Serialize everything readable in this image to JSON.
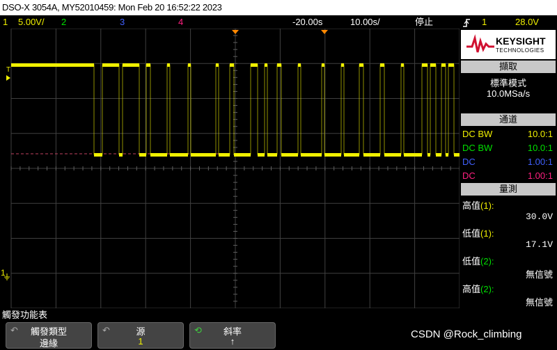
{
  "title_bar": {
    "text": "DSO-X 3054A, MY52010459: Mon Feb 20 16:52:22 2023"
  },
  "status_bar": {
    "ch1_num": "1",
    "ch1_scale": "5.00V/",
    "ch2_num": "2",
    "ch3_num": "3",
    "ch4_num": "4",
    "time_offset": "-20.00s",
    "time_scale": "10.00s/",
    "run_state": "停止",
    "trigger_icon": "rising-edge-icon",
    "trigger_source": "1",
    "trigger_level": "28.0V"
  },
  "colors": {
    "ch1": "#f0f000",
    "ch2": "#00e000",
    "ch3": "#4060ff",
    "ch4": "#ff2080",
    "trigger_marker": "#ff8800"
  },
  "screen": {
    "ch1_marker": "1",
    "trigger_level_marker": "T"
  },
  "side_panel": {
    "brand": "KEYSIGHT",
    "brand_sub": "TECHNOLOGIES",
    "acq_header": "擷取",
    "acq_mode": "標準模式",
    "acq_rate": "10.0MSa/s",
    "chan_header": "通道",
    "channels": [
      {
        "coupling": "DC BW",
        "ratio": "10.0:1"
      },
      {
        "coupling": "DC BW",
        "ratio": "10.0:1"
      },
      {
        "coupling": "DC",
        "ratio": "1.00:1"
      },
      {
        "coupling": "DC",
        "ratio": "1.00:1"
      }
    ],
    "meas_header": "量測",
    "measurements": [
      {
        "label": "高值",
        "src": "(1):",
        "value": "30.0V"
      },
      {
        "label": "低值",
        "src": "(1):",
        "value": "17.1V"
      },
      {
        "label": "低值",
        "src": "(2):",
        "value": "無信號"
      },
      {
        "label": "高值",
        "src": "(2):",
        "value": "無信號"
      }
    ]
  },
  "softkeys": {
    "menu_title": "觸發功能表",
    "keys": [
      {
        "label": "觸發類型",
        "value": "邊緣"
      },
      {
        "label": "源",
        "value": "1"
      },
      {
        "label": "斜率",
        "value": "↑"
      }
    ]
  },
  "watermark": "CSDN @Rock_climbing"
}
